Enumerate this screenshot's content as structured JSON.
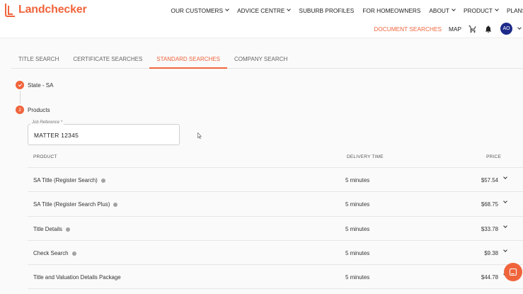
{
  "brand": {
    "name": "Landchecker",
    "color": "#f0643c"
  },
  "topnav": [
    {
      "label": "OUR CUSTOMERS",
      "dropdown": true
    },
    {
      "label": "ADVICE CENTRE",
      "dropdown": true
    },
    {
      "label": "SUBURB PROFILES",
      "dropdown": false
    },
    {
      "label": "FOR HOMEOWNERS",
      "dropdown": false
    },
    {
      "label": "ABOUT",
      "dropdown": true
    },
    {
      "label": "PRODUCT",
      "dropdown": true
    },
    {
      "label": "PLANS",
      "dropdown": false
    }
  ],
  "subnav": {
    "document_searches": "DOCUMENT SEARCHES",
    "map": "MAP",
    "cart_icon": "cart-icon",
    "bell_icon": "bell-icon",
    "avatar_initials": "AO"
  },
  "tabs": [
    {
      "label": "TITLE SEARCH",
      "active": false
    },
    {
      "label": "CERTIFICATE SEARCHES",
      "active": false
    },
    {
      "label": "STANDARD SEARCHES",
      "active": true
    },
    {
      "label": "COMPANY SEARCH",
      "active": false
    }
  ],
  "steps": [
    {
      "label": "State - SA",
      "state": "done"
    },
    {
      "label": "Products",
      "state": "current",
      "number": "2"
    }
  ],
  "job_reference": {
    "label": "Job Reference *",
    "value": "MATTER 12345"
  },
  "table": {
    "headers": {
      "product": "PRODUCT",
      "delivery": "DELIVERY TIME",
      "price": "PRICE"
    },
    "rows": [
      {
        "product": "SA Title (Register Search)",
        "delivery": "5 minutes",
        "price": "$57.54"
      },
      {
        "product": "SA Title (Register Search Plus)",
        "delivery": "5 minutes",
        "price": "$68.75"
      },
      {
        "product": "Title Details",
        "delivery": "5 minutes",
        "price": "$33.78"
      },
      {
        "product": "Check Search",
        "delivery": "5 minutes",
        "price": "$9.38"
      },
      {
        "product": "Title and Valuation Details Package",
        "delivery": "5 minutes",
        "price": "$44.78"
      }
    ]
  }
}
